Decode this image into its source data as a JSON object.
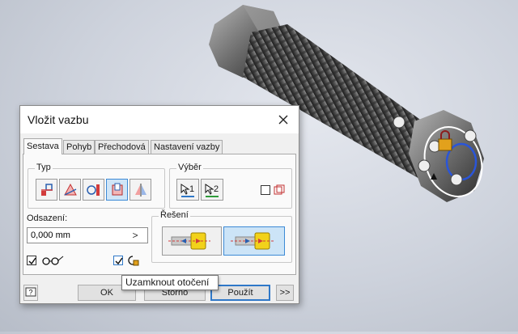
{
  "dialog": {
    "title": "Vložit vazbu",
    "close_icon": "close-icon",
    "tabs": [
      {
        "label": "Sestava",
        "active": true
      },
      {
        "label": "Pohyb",
        "active": false
      },
      {
        "label": "Přechodová",
        "active": false
      },
      {
        "label": "Nastavení vazby",
        "active": false
      }
    ],
    "type_group": {
      "label": "Typ",
      "buttons": [
        {
          "icon": "mate-constraint-icon",
          "selected": false
        },
        {
          "icon": "angle-constraint-icon",
          "selected": false
        },
        {
          "icon": "tangent-constraint-icon",
          "selected": false
        },
        {
          "icon": "insert-constraint-icon",
          "selected": true
        },
        {
          "icon": "symmetry-constraint-icon",
          "selected": false
        }
      ]
    },
    "selection_group": {
      "label": "Výběr",
      "sel1": "1",
      "sel2": "2",
      "sel_icon": "select-arrow-icon",
      "first_occurrence_checked": false,
      "first_occurrence_icon": "pick-part-first-icon"
    },
    "offset": {
      "label": "Odsazení:",
      "value": "0,000 mm",
      "arrow": ">"
    },
    "solution_group": {
      "label": "Řešení",
      "options": [
        {
          "icon": "opposed-solution-icon",
          "selected": false
        },
        {
          "icon": "aligned-solution-icon",
          "selected": true
        }
      ]
    },
    "preview_checked": true,
    "preview_icon": "glasses-icon",
    "lock_rotation_checked": true,
    "lock_rotation_icon": "lock-rotation-icon",
    "buttons": {
      "help_icon": "help-icon",
      "ok": "OK",
      "cancel": "Storno",
      "apply": "Použít",
      "more": ">>"
    },
    "tooltip": "Uzamknout otočení"
  },
  "colors": {
    "accent": "#2f78c8",
    "selected_fill": "#cfe5f7",
    "dialog_bg": "#f0f0f0"
  }
}
